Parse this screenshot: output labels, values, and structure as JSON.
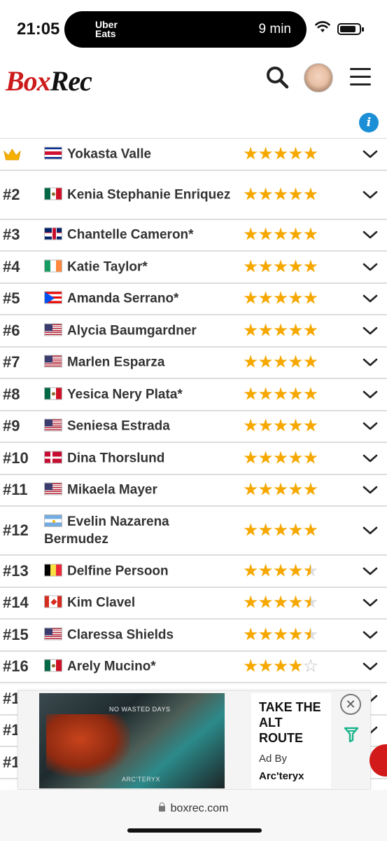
{
  "status_bar": {
    "time": "21:05",
    "activity_brand_line1": "Uber",
    "activity_brand_line2": "Eats",
    "activity_eta": "9 min"
  },
  "header": {
    "logo_part1": "Box",
    "logo_part2": "Rec"
  },
  "info_icon_glyph": "i",
  "rankings": [
    {
      "rank": "",
      "top": true,
      "flag": "f-cr",
      "name": "Yokasta Valle",
      "stars": 5
    },
    {
      "rank": "#2",
      "flag": "f-mx",
      "name": "Kenia Stephanie Enriquez",
      "stars": 5
    },
    {
      "rank": "#3",
      "flag": "f-gb",
      "name": "Chantelle Cameron*",
      "stars": 5
    },
    {
      "rank": "#4",
      "flag": "f-ie",
      "name": "Katie Taylor*",
      "stars": 5
    },
    {
      "rank": "#5",
      "flag": "f-pr",
      "name": "Amanda Serrano*",
      "stars": 5
    },
    {
      "rank": "#6",
      "flag": "f-us",
      "name": "Alycia Baumgardner",
      "stars": 5
    },
    {
      "rank": "#7",
      "flag": "f-us",
      "name": "Marlen Esparza",
      "stars": 5
    },
    {
      "rank": "#8",
      "flag": "f-mx",
      "name": "Yesica Nery Plata*",
      "stars": 5
    },
    {
      "rank": "#9",
      "flag": "f-us",
      "name": "Seniesa Estrada",
      "stars": 5
    },
    {
      "rank": "#10",
      "flag": "f-dk",
      "name": "Dina Thorslund",
      "stars": 5
    },
    {
      "rank": "#11",
      "flag": "f-us",
      "name": "Mikaela Mayer",
      "stars": 5
    },
    {
      "rank": "#12",
      "flag": "f-ar",
      "name": "Evelin Nazarena Bermudez",
      "stars": 5
    },
    {
      "rank": "#13",
      "flag": "f-be",
      "name": "Delfine Persoon",
      "stars": 4.5
    },
    {
      "rank": "#14",
      "flag": "f-ca",
      "name": "Kim Clavel",
      "stars": 4.5
    },
    {
      "rank": "#15",
      "flag": "f-us",
      "name": "Claressa Shields",
      "stars": 4.5
    },
    {
      "rank": "#16",
      "flag": "f-mx",
      "name": "Arely Mucino*",
      "stars": 4
    },
    {
      "rank": "#1",
      "flag": "",
      "name": "",
      "stars": 0
    },
    {
      "rank": "#1",
      "flag": "",
      "name": "",
      "stars": 0
    },
    {
      "rank": "#1",
      "flag": "",
      "name": "",
      "stars": 0
    }
  ],
  "ad": {
    "image_headline": "NO WASTED DAYS",
    "image_logo": "ARC'TERYX",
    "cta": "TAKE THE ALT ROUTE",
    "ad_by": "Ad By",
    "advertiser": "Arc'teryx",
    "close_glyph": "✕"
  },
  "url_bar": {
    "domain": "boxrec.com"
  },
  "colors": {
    "star": "#f6a800",
    "logo_red": "#cc1b1b",
    "info_blue": "#1a8fd6"
  }
}
